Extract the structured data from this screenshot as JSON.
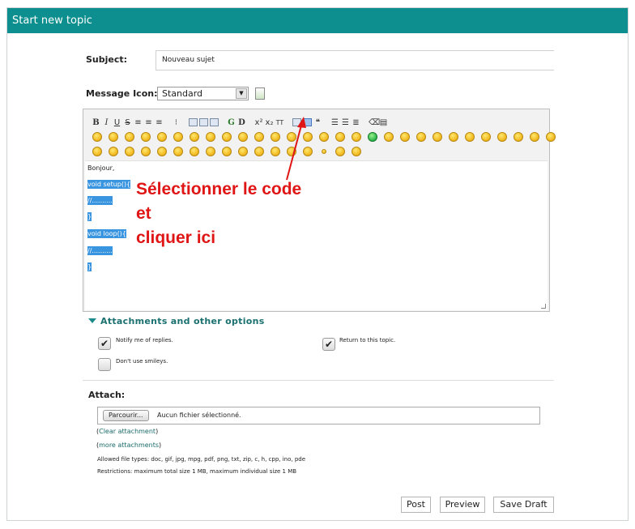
{
  "title": "Start new topic",
  "subject": {
    "label": "Subject:",
    "value": "Nouveau sujet"
  },
  "message_icon": {
    "label": "Message Icon:",
    "selected": "Standard"
  },
  "toolbar": {
    "bold": "B",
    "italic": "I",
    "underline": "U",
    "strike": "S",
    "glow": "G",
    "shadow": "D",
    "superscript": "x²",
    "subscript": "x₂",
    "tt": "TT"
  },
  "editor": {
    "lines": [
      "Bonjour,",
      "void setup(){",
      "//..........",
      "}",
      "void loop(){",
      "//..........",
      "}"
    ]
  },
  "annotation": {
    "line1": "Sélectionner le code",
    "line2": "et",
    "line3": "cliquer ici"
  },
  "attachments_header": "Attachments and other options",
  "options": {
    "notify": "Notify me of replies.",
    "return_topic": "Return to this topic.",
    "no_smileys": "Don't use smileys."
  },
  "attach": {
    "label": "Attach:",
    "browse": "Parcourir...",
    "no_file": "Aucun fichier sélectionné.",
    "clear": "Clear attachment",
    "more": "more attachments",
    "allowed": "Allowed file types: doc, gif, jpg, mpg, pdf, png, txt, zip, c, h, cpp, ino, pde",
    "restrictions": "Restrictions: maximum total size 1 MB, maximum individual size 1 MB"
  },
  "buttons": {
    "post": "Post",
    "preview": "Preview",
    "save_draft": "Save Draft"
  },
  "colors": {
    "title_bar": "#0d8f8f",
    "annotation": "#e01515",
    "selection": "#3a95e0"
  }
}
